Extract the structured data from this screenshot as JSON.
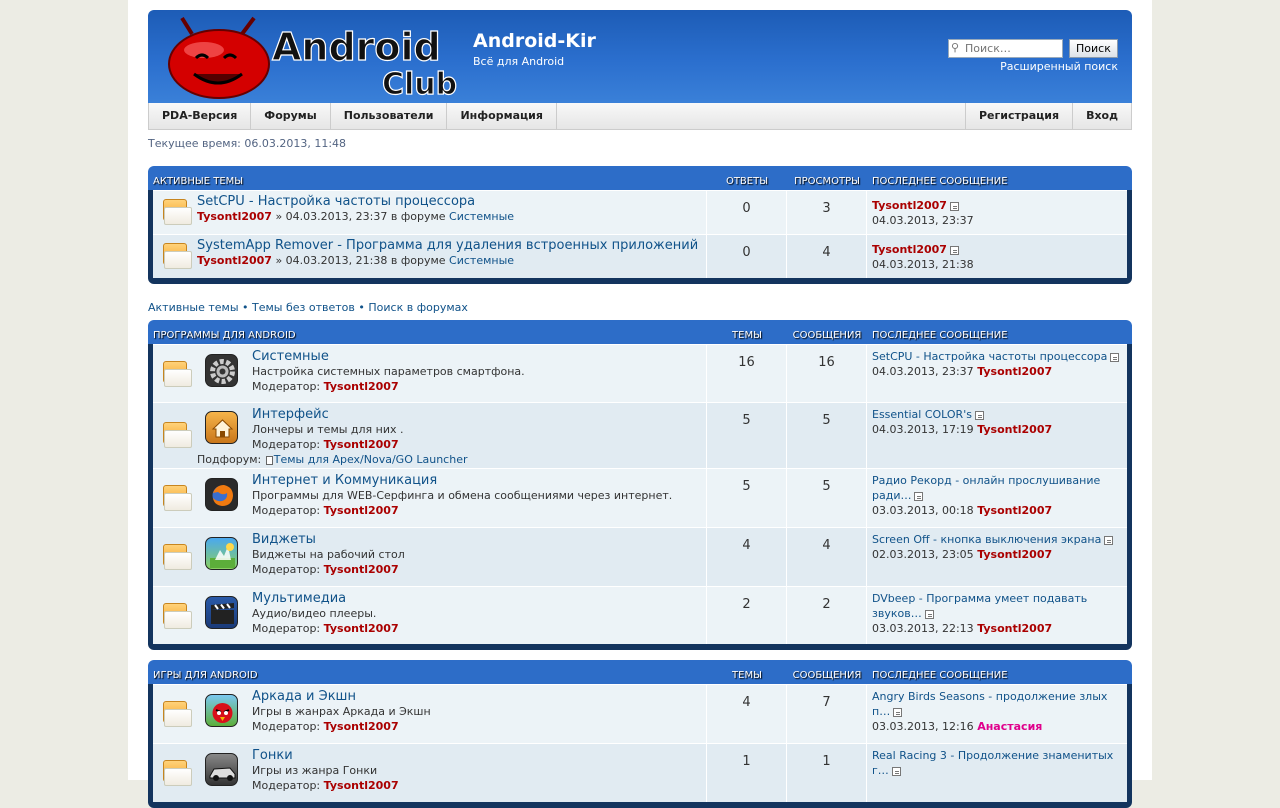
{
  "header": {
    "logo_text_1": "Android",
    "logo_text_2": "Club",
    "site_title": "Android-Kir",
    "site_desc": "Всё для Android",
    "search_placeholder": "Поиск…",
    "search_button": "Поиск",
    "advanced_search": "Расширенный поиск",
    "colors": {
      "header_blue": "#2b6fce",
      "link": "#105289",
      "author_red": "#aa0000"
    }
  },
  "nav": {
    "left": [
      "PDA-Версия",
      "Форумы",
      "Пользователи",
      "Информация"
    ],
    "right": [
      "Регистрация",
      "Вход"
    ]
  },
  "current_time": "Текущее время: 06.03.2013, 11:48",
  "active_topics": {
    "head": {
      "title": "Активные темы",
      "col_a": "Ответы",
      "col_b": "Просмотры",
      "col_last": "Последнее сообщение"
    },
    "rows": [
      {
        "title": "SetCPU - Настройка частоты процессора",
        "author": "Tysontl2007",
        "meta": " » 04.03.2013, 23:37 в форуме ",
        "forum": "Системные",
        "replies": "0",
        "views": "3",
        "last_author": "Tysontl2007",
        "last_time": "04.03.2013, 23:37"
      },
      {
        "title": "SystemApp Remover - Программа для удаления встроенных приложений",
        "author": "Tysontl2007",
        "meta": " » 04.03.2013, 21:38 в форуме ",
        "forum": "Системные",
        "replies": "0",
        "views": "4",
        "last_author": "Tysontl2007",
        "last_time": "04.03.2013, 21:38"
      }
    ]
  },
  "quick_links": [
    "Активные темы",
    "Темы без ответов",
    "Поиск в форумах"
  ],
  "quick_sep": "•",
  "programs": {
    "head": {
      "title": "Программы для Android",
      "col_a": "Темы",
      "col_b": "Сообщения",
      "col_last": "Последнее сообщение"
    },
    "rows": [
      {
        "icon": "gear-icon",
        "title": "Системные",
        "desc": "Настройка системных параметров смартфона.",
        "mod_label": "Модератор:",
        "mod": "Tysontl2007",
        "topics": "16",
        "posts": "16",
        "last_title": "SetCPU - Настройка частоты процессора",
        "last_time": "04.03.2013, 23:37",
        "last_author": "Tysontl2007"
      },
      {
        "icon": "home-icon",
        "title": "Интерфейс",
        "desc": "Лончеры и темы для них .",
        "mod_label": "Модератор:",
        "mod": "Tysontl2007",
        "sub_label": "Подфорум:",
        "sub": "Темы для Apex/Nova/GO Launcher",
        "topics": "5",
        "posts": "5",
        "last_title": "Essential COLOR's",
        "last_time": "04.03.2013, 17:19",
        "last_author": "Tysontl2007"
      },
      {
        "icon": "firefox-icon",
        "title": "Интернет и Коммуникация",
        "desc": "Программы для WEB-Серфинга и обмена сообщениями через интернет.",
        "mod_label": "Модератор:",
        "mod": "Tysontl2007",
        "topics": "5",
        "posts": "5",
        "last_title": "Радио Рекорд - онлайн прослушивание ради…",
        "last_time": "03.03.2013, 00:18",
        "last_author": "Tysontl2007"
      },
      {
        "icon": "widget-icon",
        "title": "Виджеты",
        "desc": "Виджеты на рабочий стол",
        "mod_label": "Модератор:",
        "mod": "Tysontl2007",
        "topics": "4",
        "posts": "4",
        "last_title": "Screen Off - кнопка выключения экрана",
        "last_time": "02.03.2013, 23:05",
        "last_author": "Tysontl2007"
      },
      {
        "icon": "clapperboard-icon",
        "title": "Мультимедиа",
        "desc": "Аудио/видео плееры.",
        "mod_label": "Модератор:",
        "mod": "Tysontl2007",
        "topics": "2",
        "posts": "2",
        "last_title": "DVbeep - Программа умеет подавать звуков…",
        "last_time": "03.03.2013, 22:13",
        "last_author": "Tysontl2007"
      }
    ]
  },
  "games": {
    "head": {
      "title": "Игры для Android",
      "col_a": "Темы",
      "col_b": "Сообщения",
      "col_last": "Последнее сообщение"
    },
    "rows": [
      {
        "icon": "angry-bird-icon",
        "title": "Аркада и Экшн",
        "desc": "Игры в жанрах Аркада и Экшн",
        "mod_label": "Модератор:",
        "mod": "Tysontl2007",
        "topics": "4",
        "posts": "7",
        "last_title": "Angry Birds Seasons - продолжение злых п…",
        "last_time": "03.03.2013, 12:16",
        "last_author": "Анастасия"
      },
      {
        "icon": "race-car-icon",
        "title": "Гонки",
        "desc": "Игры из жанра Гонки",
        "mod_label": "Модератор:",
        "mod": "Tysontl2007",
        "topics": "1",
        "posts": "1",
        "last_title": "Real Racing 3 - Продолжение знаменитых г…",
        "last_time": "",
        "last_author": ""
      }
    ]
  }
}
